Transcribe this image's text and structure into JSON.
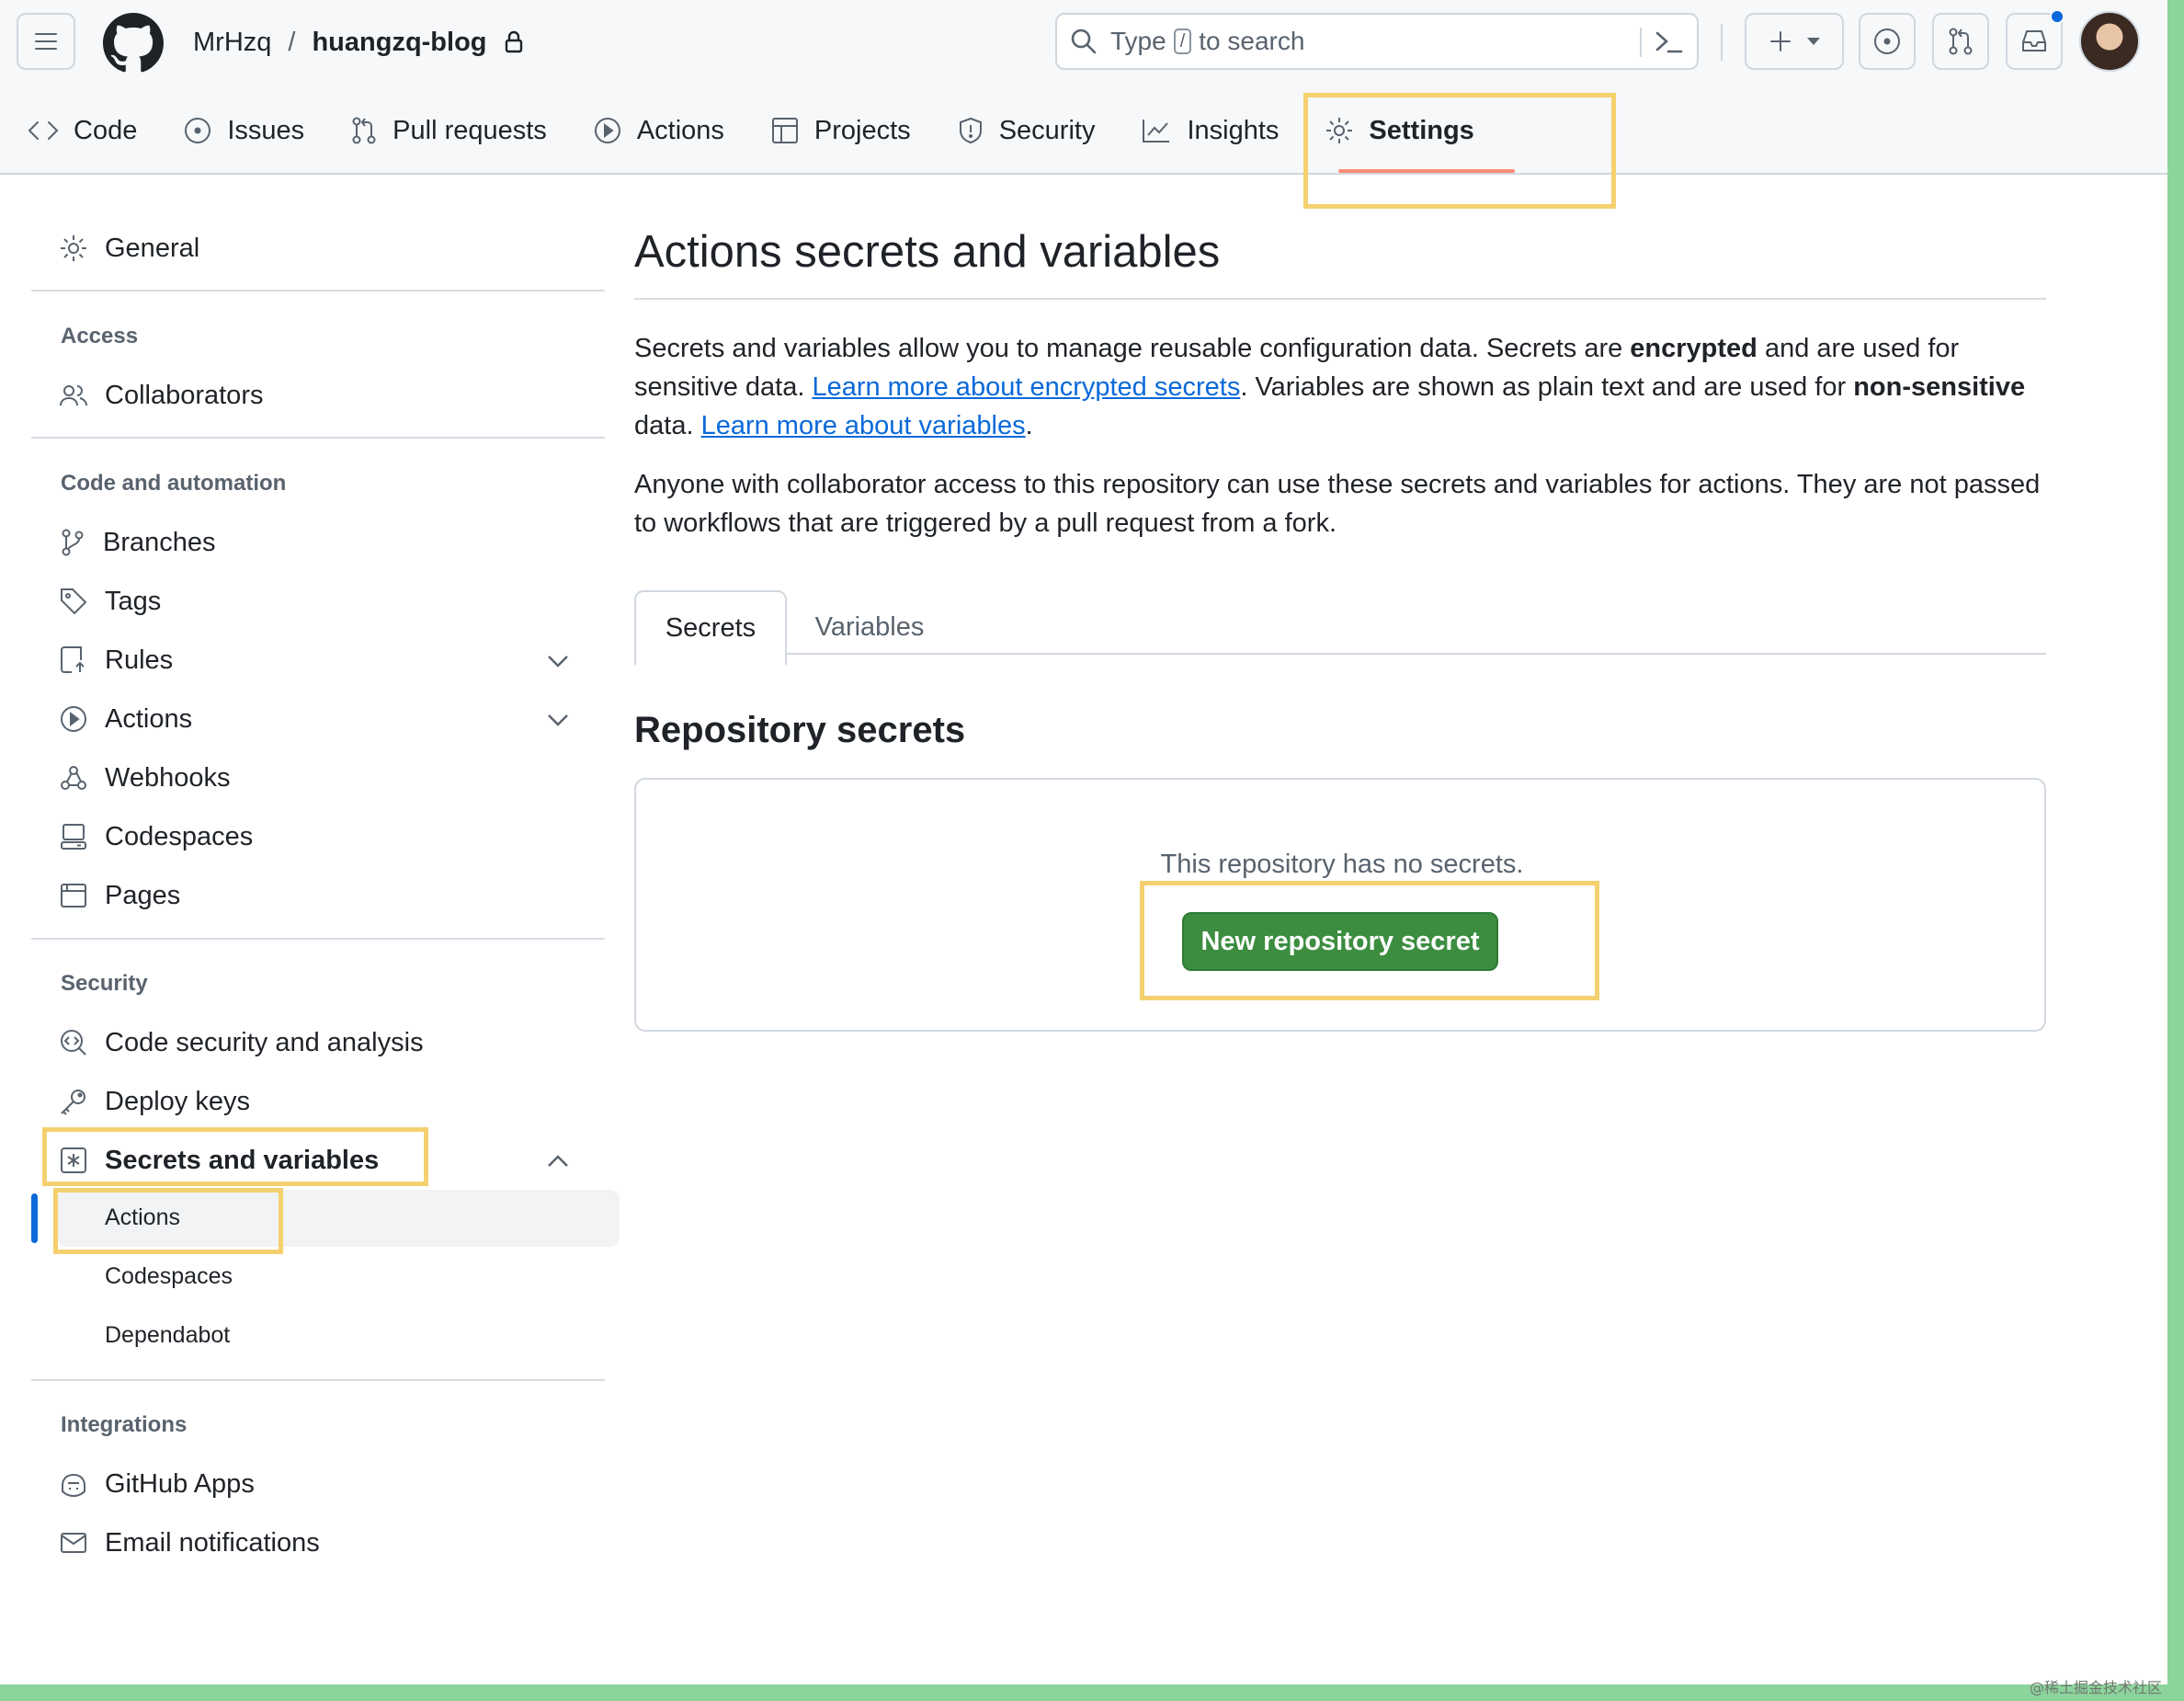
{
  "header": {
    "owner": "MrHzq",
    "separator": "/",
    "repo": "huangzq-blog",
    "search": {
      "prefix": "Type",
      "key": "/",
      "suffix": "to search"
    }
  },
  "repo_tabs": [
    {
      "label": "Code",
      "icon": "code-icon"
    },
    {
      "label": "Issues",
      "icon": "issue-opened-icon"
    },
    {
      "label": "Pull requests",
      "icon": "git-pull-request-icon"
    },
    {
      "label": "Actions",
      "icon": "play-icon"
    },
    {
      "label": "Projects",
      "icon": "table-icon"
    },
    {
      "label": "Security",
      "icon": "shield-icon"
    },
    {
      "label": "Insights",
      "icon": "graph-icon"
    },
    {
      "label": "Settings",
      "icon": "gear-icon",
      "active": true
    }
  ],
  "sidebar": {
    "general": "General",
    "sections": {
      "access": "Access",
      "code_automation": "Code and automation",
      "security": "Security",
      "integrations": "Integrations"
    },
    "items": {
      "collaborators": "Collaborators",
      "branches": "Branches",
      "tags": "Tags",
      "rules": "Rules",
      "actions": "Actions",
      "webhooks": "Webhooks",
      "codespaces": "Codespaces",
      "pages": "Pages",
      "code_security": "Code security and analysis",
      "deploy_keys": "Deploy keys",
      "secrets_variables": "Secrets and variables",
      "github_apps": "GitHub Apps",
      "email_notifications": "Email notifications"
    },
    "secrets_sub": [
      "Actions",
      "Codespaces",
      "Dependabot"
    ],
    "active_sub": "Actions"
  },
  "main": {
    "title": "Actions secrets and variables",
    "p1": {
      "a": "Secrets and variables allow you to manage reusable configuration data. Secrets are ",
      "b": "encrypted",
      "c": " and are used for sensitive data. ",
      "link1": "Learn more about encrypted secrets",
      "d": ". Variables are shown as plain text and are used for ",
      "e": "non-sensitive",
      "f": " data. ",
      "link2": "Learn more about variables",
      "g": "."
    },
    "p2": "Anyone with collaborator access to this repository can use these secrets and variables for actions. They are not passed to workflows that are triggered by a pull request from a fork.",
    "tabs": [
      "Secrets",
      "Variables"
    ],
    "active_tab": "Secrets",
    "repo_secrets_title": "Repository secrets",
    "empty_message": "This repository has no secrets.",
    "new_secret_button": "New repository secret"
  },
  "watermark": "@稀土掘金技术社区",
  "colors": {
    "accent_link": "#0969da",
    "primary_button": "#3c8d40",
    "highlight_box": "#f4d06f",
    "active_tab_underline": "#fd8c73"
  }
}
